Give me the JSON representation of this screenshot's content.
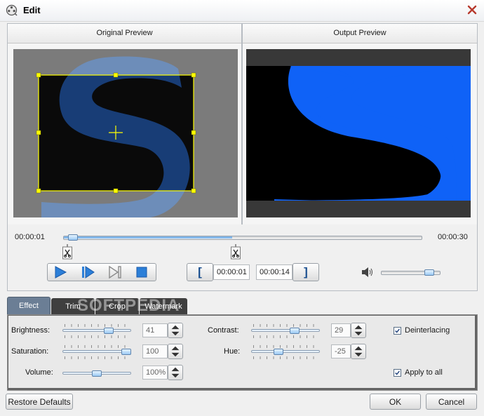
{
  "window": {
    "title": "Edit"
  },
  "preview": {
    "original_label": "Original Preview",
    "output_label": "Output Preview"
  },
  "timeline": {
    "current_time": "00:00:01",
    "end_time": "00:00:30",
    "position_fraction": 0.03
  },
  "trim_controls": {
    "start_time": "00:00:01",
    "end_time": "00:00:14"
  },
  "playback_volume_fraction": 0.9,
  "tabs": [
    {
      "label": "Effect",
      "active": true
    },
    {
      "label": "Trim",
      "active": false
    },
    {
      "label": "Crop",
      "active": false
    },
    {
      "label": "Watermark",
      "active": false
    }
  ],
  "effect": {
    "brightness": {
      "label": "Brightness:",
      "value": "41",
      "fraction": 0.7
    },
    "saturation": {
      "label": "Saturation:",
      "value": "100",
      "fraction": 1.0
    },
    "volume": {
      "label": "Volume:",
      "value": "100%",
      "fraction": 0.5
    },
    "contrast": {
      "label": "Contrast:",
      "value": "29",
      "fraction": 0.65
    },
    "hue": {
      "label": "Hue:",
      "value": "-25",
      "fraction": 0.38
    },
    "deinterlacing": {
      "label": "Deinterlacing",
      "checked": true
    },
    "apply_to_all": {
      "label": "Apply to all",
      "checked": true
    }
  },
  "watermark_overlay": "SOFTPEDIA",
  "buttons": {
    "restore": "Restore Defaults",
    "ok": "OK",
    "cancel": "Cancel"
  },
  "colors": {
    "accent_blue": "#0f62f7",
    "crop_box": "#ffff00",
    "tab_active": "#6b7e95",
    "tab_inactive": "#3f3f3f"
  }
}
